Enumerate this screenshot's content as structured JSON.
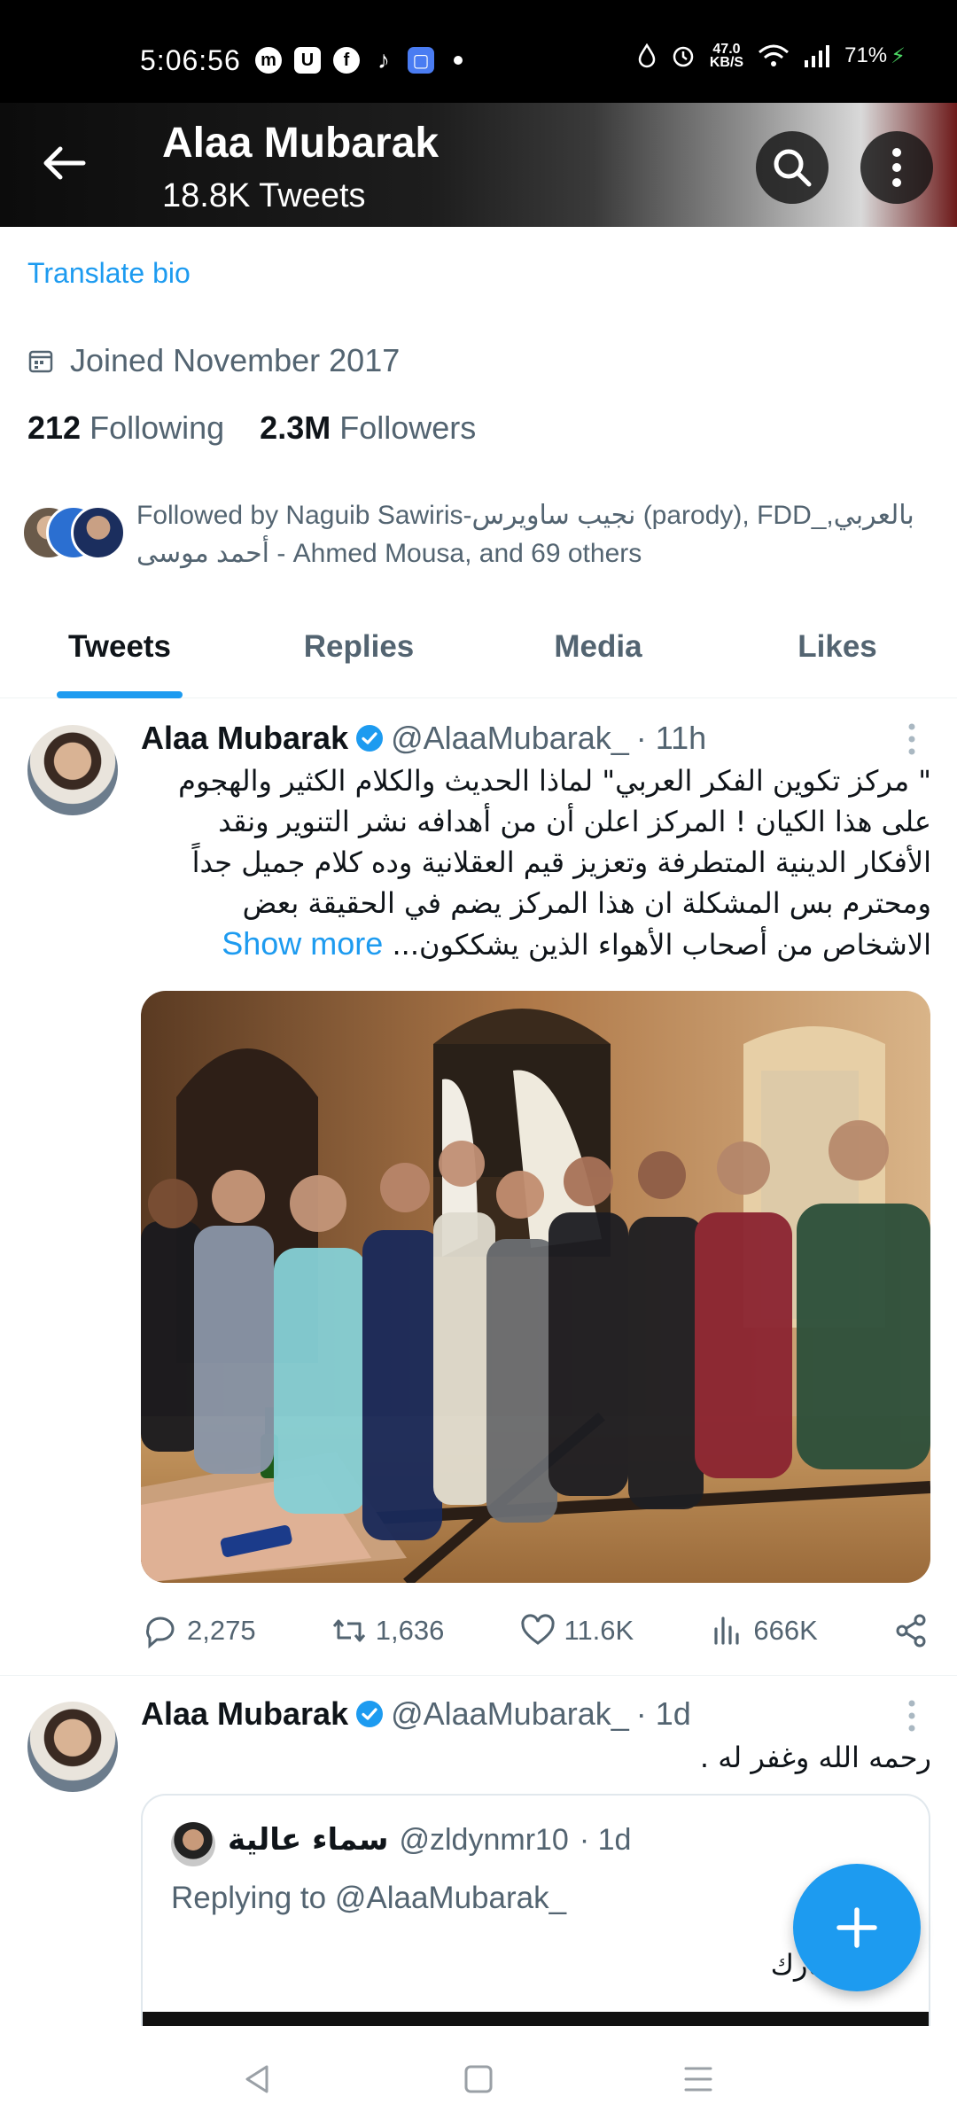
{
  "status_bar": {
    "time": "5:06:56",
    "left_icons": [
      "messenger-icon",
      "u-app-icon",
      "facebook-icon",
      "tiktok-icon",
      "app-icon"
    ],
    "net_speed": "47.0",
    "net_unit": "KB/S",
    "battery": "71%"
  },
  "header": {
    "name": "Alaa Mubarak",
    "tweet_count": "18.8K Tweets"
  },
  "profile": {
    "translate_bio": "Translate bio",
    "joined": "Joined November 2017",
    "following_count": "212",
    "following_label": "Following",
    "followers_count": "2.3M",
    "followers_label": "Followers",
    "followed_by": "Followed by Naguib Sawiris-نجيب ساويرس (parody), FDD_بالعربي, أحمد موسى - Ahmed Mousa, and 69 others"
  },
  "tabs": [
    {
      "label": "Tweets",
      "active": true
    },
    {
      "label": "Replies",
      "active": false
    },
    {
      "label": "Media",
      "active": false
    },
    {
      "label": "Likes",
      "active": false
    }
  ],
  "tweets": [
    {
      "name": "Alaa Mubarak",
      "handle": "@AlaaMubarak_",
      "time": "· 11h",
      "text": "\" مركز تكوين الفكر العربي\" لماذا الحديث والكلام الكثير والهجوم على هذا الكيان ! المركز اعلن أن من أهدافه نشر التنوير ونقد الأفكار الدينية المتطرفة وتعزيز قيم العقلانية وده كلام جميل جداً ومحترم بس المشكلة ان هذا المركز يضم في الحقيقة بعض الاشخاص من أصحاب الأهواء الذين يشككون...",
      "show_more": "Show more",
      "replies": "2,275",
      "retweets": "1,636",
      "likes": "11.6K",
      "views": "666K"
    },
    {
      "name": "Alaa Mubarak",
      "handle": "@AlaaMubarak_",
      "time": "· 1d",
      "text": "رحمه الله وغفر له .",
      "quote": {
        "name": "سماء عالية",
        "handle": "@zldynmr10",
        "time": "· 1d",
        "replying_to": "Replying to @AlaaMubarak_",
        "text": "مبارك"
      }
    }
  ],
  "colors": {
    "accent": "#1d9bf0",
    "secondary_text": "#536471",
    "primary_text": "#0f1419"
  }
}
